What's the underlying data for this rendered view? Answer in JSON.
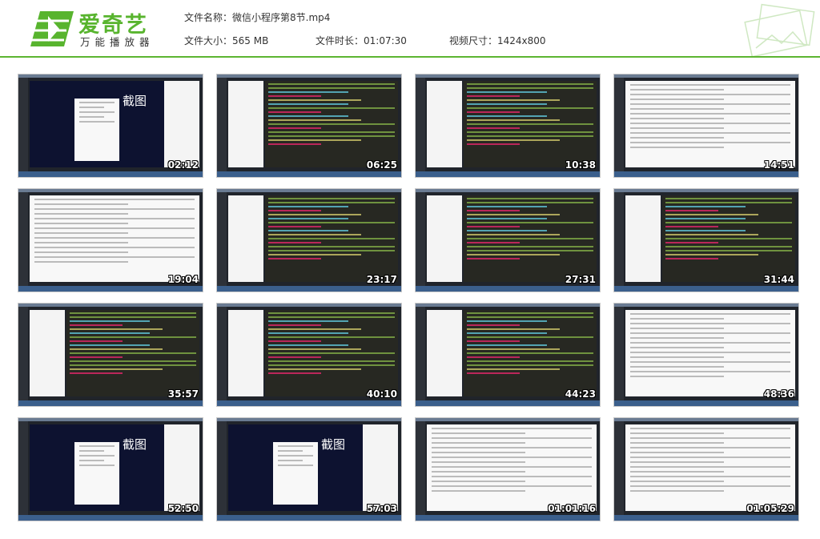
{
  "logo": {
    "brand": "爱奇艺",
    "subtitle": "万能播放器",
    "colors": {
      "primary": "#58b42e",
      "dark": "#3c8a1e"
    }
  },
  "file_info": {
    "name_label": "文件名称：微信小程序第8节.mp4",
    "size_label": "文件大小：565 MB",
    "duration_label": "文件时长：01:07:30",
    "resolution_label": "视频尺寸：1424x800"
  },
  "thumbnails": [
    {
      "time": "02:12",
      "scene": "screenshot",
      "caption": "截图"
    },
    {
      "time": "06:25",
      "scene": "code"
    },
    {
      "time": "10:38",
      "scene": "code"
    },
    {
      "time": "14:51",
      "scene": "light"
    },
    {
      "time": "19:04",
      "scene": "light"
    },
    {
      "time": "23:17",
      "scene": "code"
    },
    {
      "time": "27:31",
      "scene": "code"
    },
    {
      "time": "31:44",
      "scene": "code"
    },
    {
      "time": "35:57",
      "scene": "code"
    },
    {
      "time": "40:10",
      "scene": "code"
    },
    {
      "time": "44:23",
      "scene": "code"
    },
    {
      "time": "48:36",
      "scene": "light"
    },
    {
      "time": "52:50",
      "scene": "screenshot",
      "caption": "截图"
    },
    {
      "time": "57:03",
      "scene": "screenshot",
      "caption": "截图"
    },
    {
      "time": "01:01:16",
      "scene": "light"
    },
    {
      "time": "01:05:29",
      "scene": "light"
    }
  ]
}
